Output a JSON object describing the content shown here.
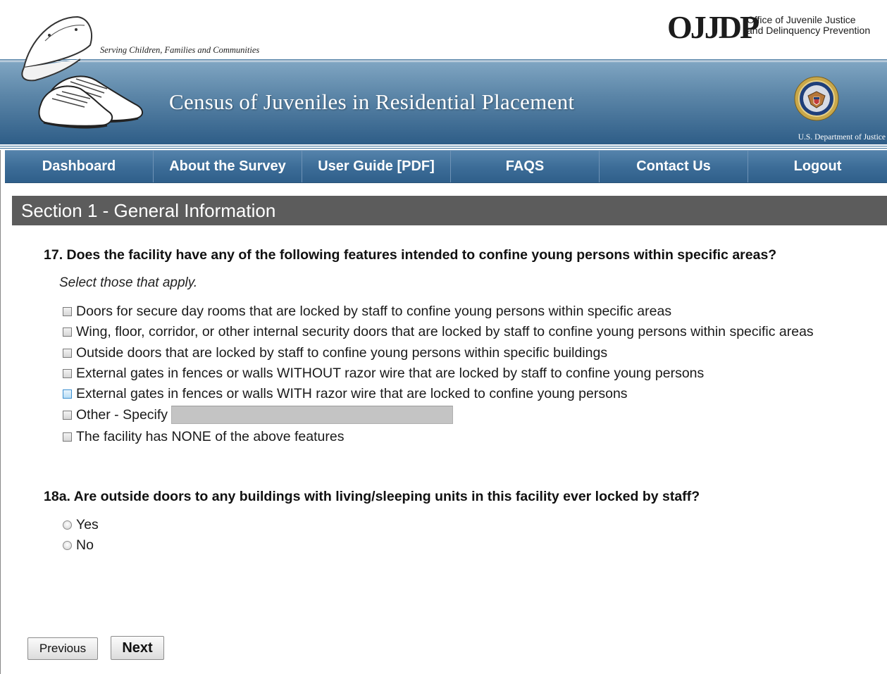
{
  "header": {
    "tagline": "Serving Children, Families and Communities",
    "agency_mark": "OJJDP",
    "agency_line1": "Office of Juvenile Justice",
    "agency_line2": "and Delinquency Prevention",
    "site_title": "Census of Juveniles in Residential Placement",
    "department": "U.S. Department of Justice"
  },
  "nav": {
    "items": [
      {
        "label": "Dashboard"
      },
      {
        "label": "About the Survey"
      },
      {
        "label": "User Guide [PDF]"
      },
      {
        "label": "FAQS"
      },
      {
        "label": "Contact Us"
      },
      {
        "label": "Logout"
      }
    ]
  },
  "section": {
    "title": "Section 1 - General Information"
  },
  "q17": {
    "question": "17. Does the facility have any of the following features intended to confine young persons within specific areas?",
    "instruction": "Select those that apply.",
    "options": [
      {
        "label": "Doors for secure day rooms that are locked by staff to confine young persons within specific areas",
        "checked": false
      },
      {
        "label": "Wing, floor, corridor, or other internal security doors that are locked by staff to confine young persons within specific areas",
        "checked": false
      },
      {
        "label": "Outside doors that are locked by staff to confine young persons within specific buildings",
        "checked": false
      },
      {
        "label": "External gates in fences or walls WITHOUT razor wire that are locked by staff to confine young persons",
        "checked": false
      },
      {
        "label": "External gates in fences or walls WITH razor wire that are locked to confine young persons",
        "checked": false
      },
      {
        "label": "Other - Specify",
        "checked": false
      },
      {
        "label": "The facility has NONE of the above features",
        "checked": false
      }
    ],
    "specify_value": ""
  },
  "q18a": {
    "question": "18a. Are outside doors to any buildings with living/sleeping units in this facility ever locked by staff?",
    "options": [
      {
        "label": "Yes",
        "selected": false
      },
      {
        "label": "No",
        "selected": false
      }
    ]
  },
  "buttons": {
    "previous": "Previous",
    "next": "Next"
  },
  "colors": {
    "nav_bg": "#3d6d98",
    "section_bg": "#5c5c5c",
    "banner_bottom": "#2e5d87"
  }
}
